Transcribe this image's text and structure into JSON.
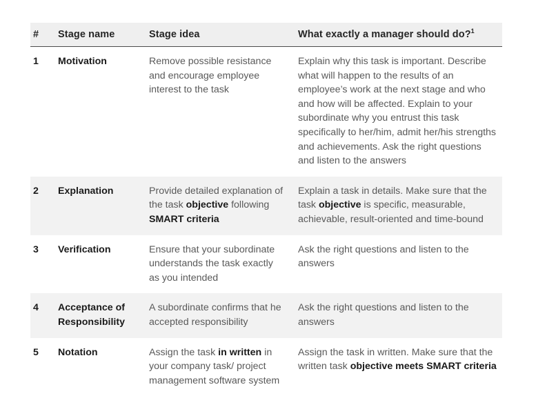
{
  "table": {
    "columns": [
      {
        "key": "num",
        "label": "#"
      },
      {
        "key": "name",
        "label": "Stage name"
      },
      {
        "key": "idea",
        "label": "Stage idea"
      },
      {
        "key": "doing",
        "label": "What exactly a manager should do?",
        "footnote": "1"
      }
    ],
    "rows": [
      {
        "num": "1",
        "name": "Motivation",
        "idea_html": "Remove possible resistance and encourage employee interest to the task",
        "idea_text": "Remove possible resistance and encourage employee interest to the task",
        "doing_html": "Explain why this task is important. Describe what will happen to the results of an employee’s work at the next stage and who and how will be affected. Explain to your subordinate why you entrust this task specifically to her/him, admit her/his strengths and achievements. Ask the right questions and listen to the answers",
        "doing_text": "Explain why this task is important. Describe what will happen to the results of an employee’s work at the next stage and who and how will be affected. Explain to your subordinate why you entrust this task specifically to her/him, admit her/his strengths and achievements. Ask the right questions and listen to the answers",
        "shaded": false
      },
      {
        "num": "2",
        "name": "Explanation",
        "idea_html": "Provide detailed explanation of the task <b>objective</b> following <b>SMART criteria</b>",
        "idea_text": "Provide detailed explanation of the task objective following SMART criteria",
        "doing_html": "Explain a task in details. Make sure that the task <b>objective</b> is specific, measurable, achievable, result-oriented and time-bound",
        "doing_text": "Explain a task in details. Make sure that the task objective is specific, measurable, achievable, result-oriented and time-bound",
        "shaded": true
      },
      {
        "num": "3",
        "name": "Verification",
        "idea_html": "Ensure that your subordinate understands the task exactly as you intended",
        "idea_text": "Ensure that your subordinate understands the task exactly as you intended",
        "doing_html": "Ask the right questions and listen to the answers",
        "doing_text": "Ask the right questions and listen to the answers",
        "shaded": false
      },
      {
        "num": "4",
        "name": "Acceptance of Responsibility",
        "idea_html": "A subordinate confirms that he accepted responsibility",
        "idea_text": "A subordinate confirms that he accepted responsibility",
        "doing_html": "Ask the right questions and listen to the answers",
        "doing_text": "Ask the right questions and listen to the answers",
        "shaded": true
      },
      {
        "num": "5",
        "name": "Notation",
        "idea_html": "Assign the task <b>in written</b> in your company task/ project management software system",
        "idea_text": "Assign the task in written in your company task/ project management software system",
        "doing_html": "Assign the task in written. Make sure that the written task <b>objective meets SMART criteria</b>",
        "doing_text": "Assign the task in written. Make sure that the written task objective meets SMART criteria",
        "shaded": false
      }
    ]
  },
  "colors": {
    "header_band": "#efefef",
    "header_rule": "#4a4a4a",
    "row_band": "#f2f2f2",
    "body_text": "#595959",
    "emphasis_text": "#1a1a1a",
    "page_background": "#ffffff"
  }
}
